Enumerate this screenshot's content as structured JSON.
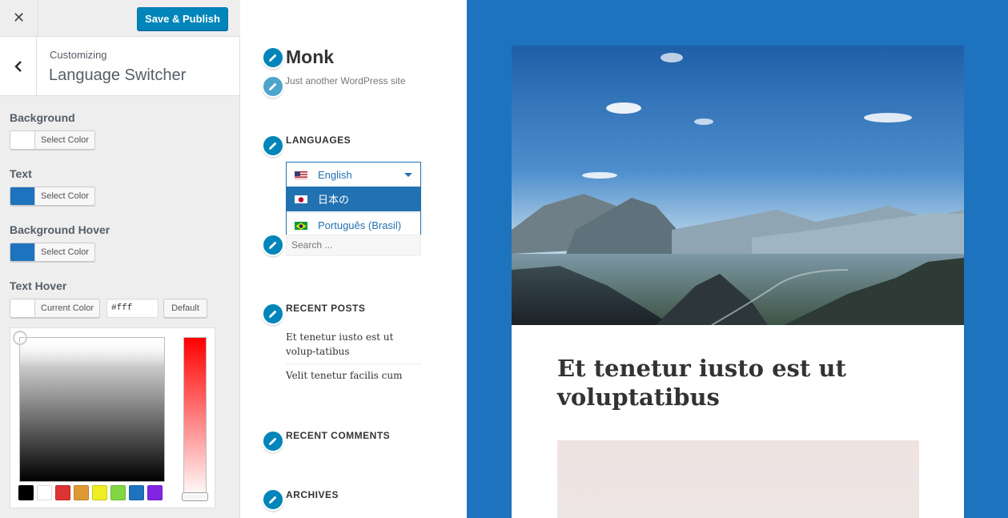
{
  "customizer": {
    "close_label": "✕",
    "save_label": "Save & Publish",
    "customizing_label": "Customizing",
    "section_name": "Language Switcher",
    "controls": [
      {
        "label": "Background",
        "button_text": "Select Color",
        "color": "#ffffff"
      },
      {
        "label": "Text",
        "button_text": "Select Color",
        "color": "#1e73be"
      },
      {
        "label": "Background Hover",
        "button_text": "Select Color",
        "color": "#1e73be"
      },
      {
        "label": "Text Hover",
        "button_text": "Current Color",
        "color": "#ffffff"
      }
    ],
    "hex_value": "#fff",
    "default_label": "Default",
    "palette": [
      "#000000",
      "#ffffff",
      "#dd3333",
      "#dd9933",
      "#eeee22",
      "#81d742",
      "#1e73be",
      "#8224e3"
    ]
  },
  "site": {
    "title": "Monk",
    "description": "Just another WordPress site",
    "languages_title": "LANGUAGES",
    "languages": [
      {
        "name": "English",
        "flag": "us"
      },
      {
        "name": "日本の",
        "flag": "jp"
      },
      {
        "name": "Português (Brasil)",
        "flag": "br"
      }
    ],
    "search_placeholder": "Search ...",
    "recent_posts_title": "RECENT POSTS",
    "recent_posts": [
      "Et tenetur iusto est ut volup-tatibus",
      "Velit tenetur facilis cum"
    ],
    "recent_comments_title": "RECENT COMMENTS",
    "archives_title": "ARCHIVES"
  },
  "post": {
    "title": "Et tenetur iusto est ut voluptatibus"
  },
  "colors": {
    "accent": "#0085ba",
    "content_bg": "#1e73be",
    "link": "#2271b1"
  }
}
